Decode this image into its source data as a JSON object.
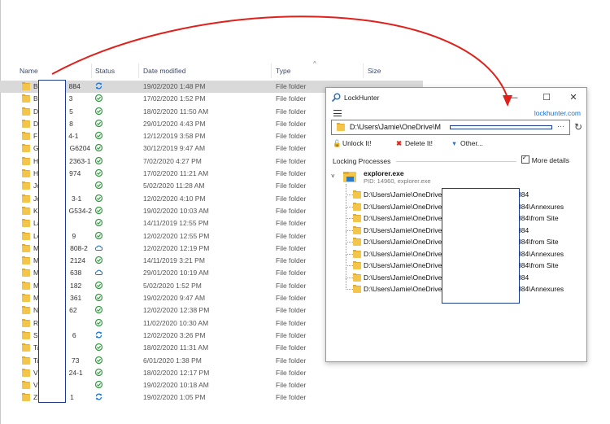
{
  "explorer": {
    "columns": {
      "name": "Name",
      "status": "Status",
      "date": "Date modified",
      "type": "Type",
      "size": "Size"
    },
    "rows": [
      {
        "name": "B",
        "suffix": "884",
        "status": "sync",
        "date": "19/02/2020 1:48 PM",
        "type": "File folder",
        "selected": true
      },
      {
        "name": "B",
        "suffix": "3",
        "status": "ok",
        "date": "17/02/2020 1:52 PM",
        "type": "File folder"
      },
      {
        "name": "D",
        "suffix": "5",
        "status": "ok",
        "date": "18/02/2020 11:50 AM",
        "type": "File folder"
      },
      {
        "name": "D",
        "suffix": "8",
        "status": "ok",
        "date": "29/01/2020 4:43 PM",
        "type": "File folder"
      },
      {
        "name": "F",
        "suffix": "4-1",
        "status": "ok",
        "date": "12/12/2019 3:58 PM",
        "type": "File folder"
      },
      {
        "name": "G",
        "suffix": "G6204",
        "status": "ok",
        "date": "30/12/2019 9:47 AM",
        "type": "File folder"
      },
      {
        "name": "H",
        "suffix": "2363-1",
        "status": "ok",
        "date": "7/02/2020 4:27 PM",
        "type": "File folder"
      },
      {
        "name": "H",
        "suffix": "974",
        "status": "ok",
        "date": "17/02/2020 11:21 AM",
        "type": "File folder"
      },
      {
        "name": "Jo",
        "suffix": "",
        "status": "ok",
        "date": "5/02/2020 11:28 AM",
        "type": "File folder"
      },
      {
        "name": "Jo",
        "suffix": "3-1",
        "status": "ok",
        "date": "12/02/2020 4:10 PM",
        "type": "File folder"
      },
      {
        "name": "K",
        "suffix": "G534-2",
        "status": "ok",
        "date": "19/02/2020 10:03 AM",
        "type": "File folder"
      },
      {
        "name": "La",
        "suffix": "",
        "status": "ok",
        "date": "14/11/2019 12:55 PM",
        "type": "File folder"
      },
      {
        "name": "Le",
        "suffix": "9",
        "status": "ok",
        "date": "12/02/2020 12:55 PM",
        "type": "File folder"
      },
      {
        "name": "M",
        "suffix": "808-2",
        "status": "cloud",
        "date": "12/02/2020 12:19 PM",
        "type": "File folder"
      },
      {
        "name": "M",
        "suffix": "2124",
        "status": "ok",
        "date": "14/11/2019 3:21 PM",
        "type": "File folder"
      },
      {
        "name": "M",
        "suffix": "638",
        "status": "cloud",
        "date": "29/01/2020 10:19 AM",
        "type": "File folder"
      },
      {
        "name": "M",
        "suffix": "182",
        "status": "ok",
        "date": "5/02/2020 1:52 PM",
        "type": "File folder"
      },
      {
        "name": "M",
        "suffix": "361",
        "status": "ok",
        "date": "19/02/2020 9:47 AM",
        "type": "File folder"
      },
      {
        "name": "N",
        "suffix": "62",
        "status": "ok",
        "date": "12/02/2020 12:38 PM",
        "type": "File folder"
      },
      {
        "name": "R",
        "suffix": "",
        "status": "ok",
        "date": "11/02/2020 10:30 AM",
        "type": "File folder"
      },
      {
        "name": "Sc",
        "suffix": "6",
        "status": "sync",
        "date": "12/02/2020 3:26 PM",
        "type": "File folder"
      },
      {
        "name": "Ta",
        "suffix": "",
        "status": "ok",
        "date": "18/02/2020 11:31 AM",
        "type": "File folder"
      },
      {
        "name": "Ta",
        "suffix": "73",
        "status": "ok",
        "date": "6/01/2020 1:38 PM",
        "type": "File folder"
      },
      {
        "name": "V",
        "suffix": "24-1",
        "status": "ok",
        "date": "18/02/2020 12:17 PM",
        "type": "File folder"
      },
      {
        "name": "V",
        "suffix": "",
        "status": "ok",
        "date": "19/02/2020 10:18 AM",
        "type": "File folder"
      },
      {
        "name": "Zl",
        "suffix": "1",
        "status": "sync",
        "date": "19/02/2020 1:05 PM",
        "type": "File folder"
      }
    ]
  },
  "lockhunter": {
    "title": "LockHunter",
    "minimize": "—",
    "maximize": "☐",
    "close": "✕",
    "link": "lockhunter.com",
    "path": "D:\\Users\\Jamie\\OneDrive\\M",
    "path_more": "···",
    "buttons": {
      "unlock": "Unlock It!",
      "delete": "Delete It!",
      "other": "Other..."
    },
    "section": "Locking Processes",
    "more_details": "More details",
    "process": {
      "name": "explorer.exe",
      "pid": "PID: 14960, explorer.exe"
    },
    "files": [
      {
        "prefix": "D:\\Users\\Jamie\\OneDrive\\M",
        "suffix": "884"
      },
      {
        "prefix": "D:\\Users\\Jamie\\OneDrive\\M",
        "suffix": "884\\Annexures"
      },
      {
        "prefix": "D:\\Users\\Jamie\\OneDrive\\M",
        "suffix": "884\\from Site"
      },
      {
        "prefix": "D:\\Users\\Jamie\\OneDrive\\M",
        "suffix": "884"
      },
      {
        "prefix": "D:\\Users\\Jamie\\OneDrive\\M",
        "suffix": "884\\from Site"
      },
      {
        "prefix": "D:\\Users\\Jamie\\OneDrive\\M",
        "suffix": "884\\Annexures"
      },
      {
        "prefix": "D:\\Users\\Jamie\\OneDrive\\M",
        "suffix": "884\\from Site"
      },
      {
        "prefix": "D:\\Users\\Jamie\\OneDrive\\M",
        "suffix": "884"
      },
      {
        "prefix": "D:\\Users\\Jamie\\OneDrive\\M",
        "suffix": "884\\Annexures"
      }
    ]
  },
  "colors": {
    "accent": "#1a6fcf",
    "annotation_arrow": "#e0201b",
    "status_ok": "#2f9a3f",
    "redaction_border": "#1c3d8f"
  }
}
